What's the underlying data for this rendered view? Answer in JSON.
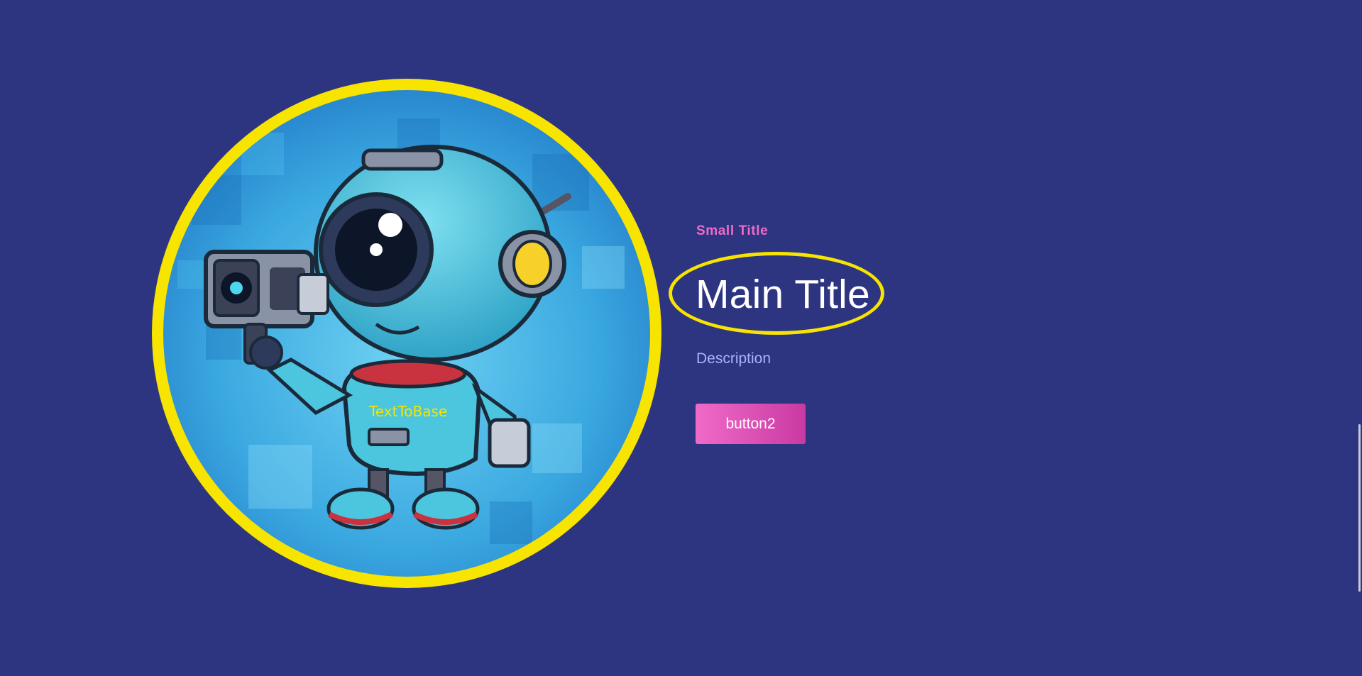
{
  "theme": {
    "background": "#2e3580",
    "accent_ring": "#f7e400",
    "small_title_color": "#f06ac8",
    "description_color": "#aab2ff",
    "button_gradient_start": "#f06ac8",
    "button_gradient_end": "#c93aa2"
  },
  "hero": {
    "image_icon": "robot-with-camera-illustration",
    "image_text": "TextToBase"
  },
  "content": {
    "small_title": "Small Title",
    "main_title": "Main Title",
    "description": "Description",
    "button_label": "button2"
  }
}
